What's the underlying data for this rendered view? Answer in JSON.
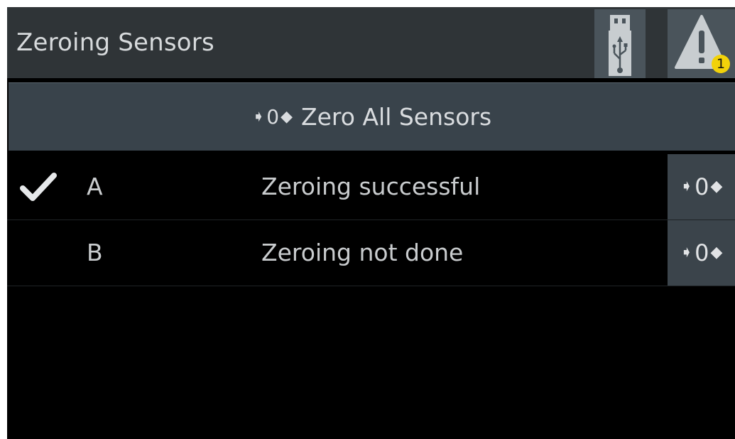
{
  "header": {
    "title": "Zeroing Sensors",
    "usb_icon": "usb-icon",
    "warning_icon": "warning-icon",
    "warning_count": "1",
    "warning_badge_color": "#f2d20a"
  },
  "zero_all": {
    "label": "Zero All Sensors",
    "zero_glyph": "0",
    "icon": "zero-arrows-icon"
  },
  "sensors": [
    {
      "name": "A",
      "status": "Zeroing successful",
      "checked": true,
      "zero_glyph": "0"
    },
    {
      "name": "B",
      "status": "Zeroing not done",
      "checked": false,
      "zero_glyph": "0"
    }
  ],
  "colors": {
    "header_bg": "#2f3437",
    "button_bg": "#39434b",
    "text": "#d7dadc",
    "background": "#000000"
  }
}
